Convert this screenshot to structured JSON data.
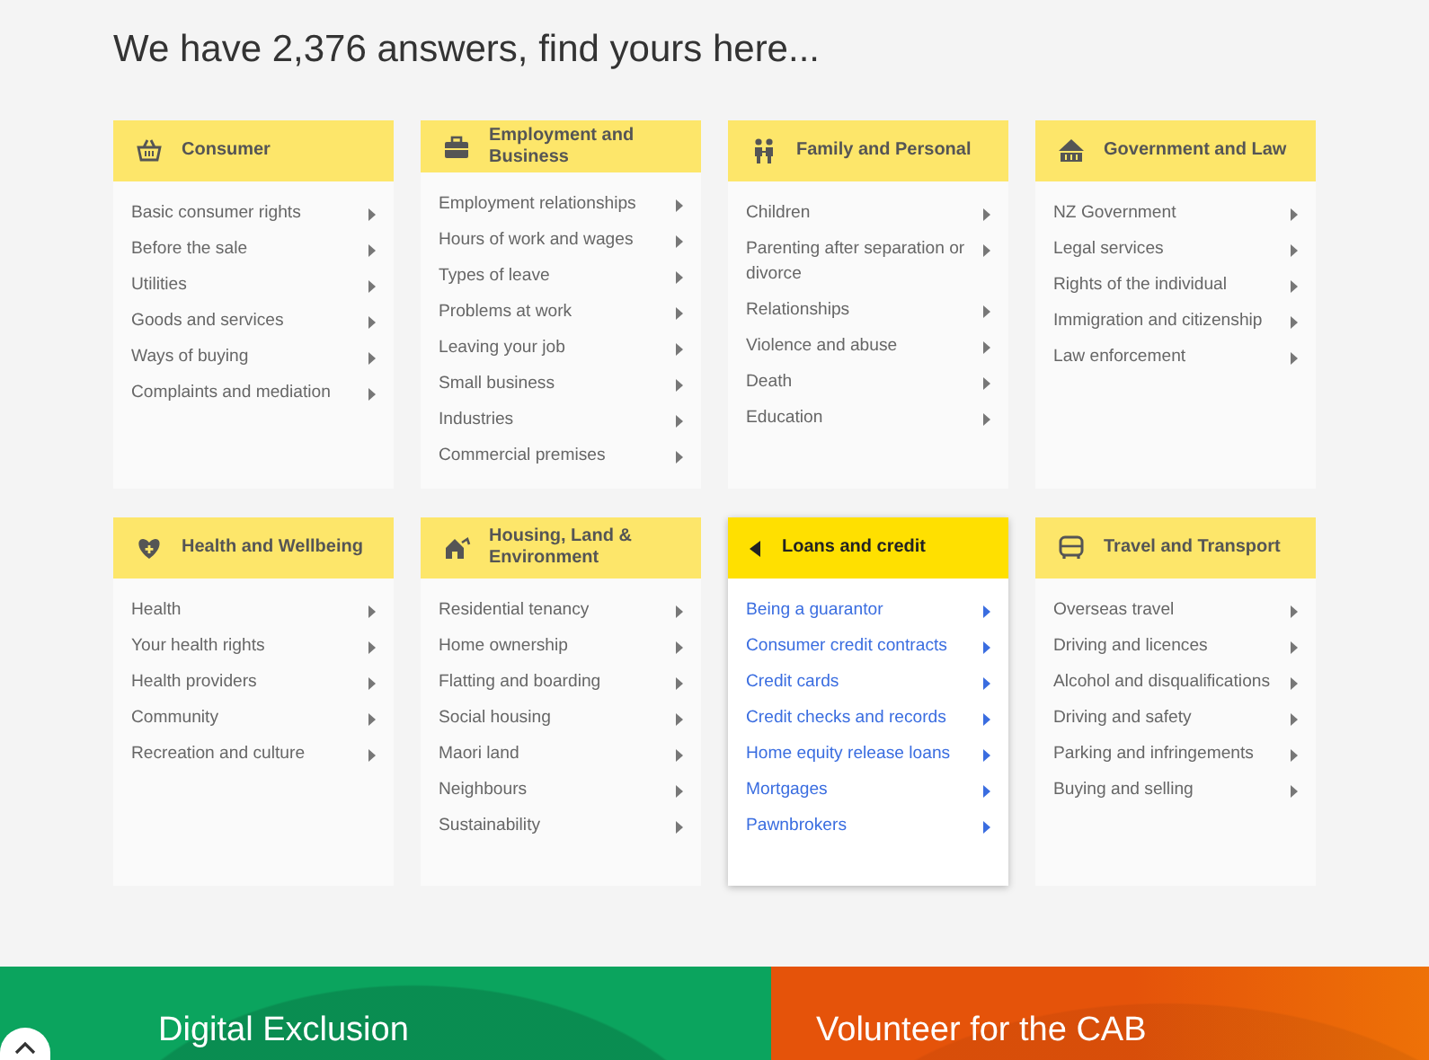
{
  "heading": "We have 2,376 answers, find yours here...",
  "categories": [
    {
      "title": "Consumer",
      "kind": "basket",
      "selected": false,
      "items": [
        "Basic consumer rights",
        "Before the sale",
        "Utilities",
        "Goods and services",
        "Ways of buying",
        "Complaints and mediation"
      ]
    },
    {
      "title": "Employment and Business",
      "kind": "briefcase",
      "selected": false,
      "items": [
        "Employment relationships",
        "Hours of work and wages",
        "Types of leave",
        "Problems at work",
        "Leaving your job",
        "Small business",
        "Industries",
        "Commercial premises"
      ]
    },
    {
      "title": "Family and Personal",
      "kind": "family",
      "selected": false,
      "items": [
        "Children",
        "Parenting after separation or divorce",
        "Relationships",
        "Violence and abuse",
        "Death",
        "Education"
      ]
    },
    {
      "title": "Government and Law",
      "kind": "building",
      "selected": false,
      "items": [
        "NZ Government",
        "Legal services",
        "Rights of the individual",
        "Immigration and citizenship",
        "Law enforcement"
      ]
    },
    {
      "title": "Health and Wellbeing",
      "kind": "heart",
      "selected": false,
      "items": [
        "Health",
        "Your health rights",
        "Health providers",
        "Community",
        "Recreation and culture"
      ]
    },
    {
      "title": "Housing, Land & Environment",
      "kind": "house",
      "selected": false,
      "items": [
        "Residential tenancy",
        "Home ownership",
        "Flatting and boarding",
        "Social housing",
        "Maori land",
        "Neighbours",
        "Sustainability"
      ]
    },
    {
      "title": "Loans and credit",
      "selected": true,
      "items": [
        "Being a guarantor",
        "Consumer credit contracts",
        "Credit cards",
        "Credit checks and records",
        "Home equity release loans",
        "Mortgages",
        "Pawnbrokers"
      ]
    },
    {
      "title": "Travel and Transport",
      "kind": "bus",
      "selected": false,
      "items": [
        "Overseas travel",
        "Driving and licences",
        "Alcohol and disqualifications",
        "Driving and safety",
        "Parking and infringements",
        "Buying and selling"
      ]
    }
  ],
  "banners": [
    {
      "title": "Digital Exclusion",
      "color": "#0ba45e"
    },
    {
      "title": "Volunteer for the CAB",
      "color": "#e5530a"
    }
  ]
}
